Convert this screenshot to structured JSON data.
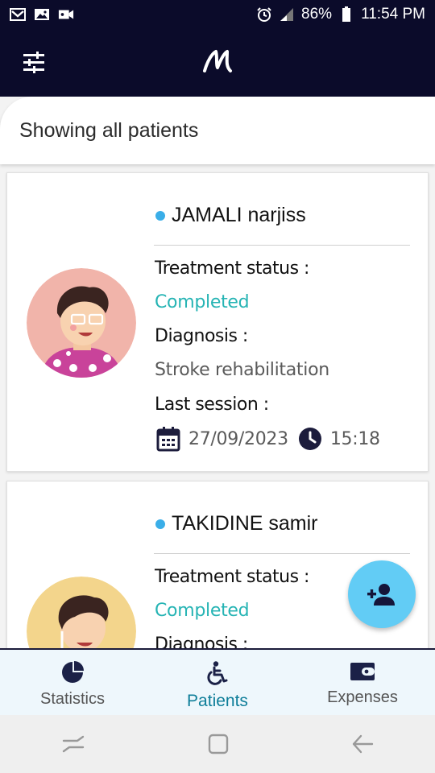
{
  "status_bar": {
    "battery": "86%",
    "time": "11:54 PM"
  },
  "header": {
    "title": "Showing all patients"
  },
  "patients": [
    {
      "name": "JAMALI narjiss",
      "treatment_status_label": "Treatment status :",
      "treatment_status": "Completed",
      "diagnosis_label": "Diagnosis :",
      "diagnosis": "Stroke rehabilitation",
      "last_session_label": "Last session :",
      "last_session_date": "27/09/2023",
      "last_session_time": "15:18"
    },
    {
      "name": "TAKIDINE samir",
      "treatment_status_label": "Treatment status :",
      "treatment_status": "Completed",
      "diagnosis_label": "Diagnosis :"
    }
  ],
  "bottom_nav": {
    "items": [
      {
        "label": "Statistics",
        "icon": "pie-chart-icon"
      },
      {
        "label": "Patients",
        "icon": "accessible-icon",
        "active": true
      },
      {
        "label": "Expenses",
        "icon": "wallet-icon"
      }
    ]
  },
  "colors": {
    "dark_navy": "#0b0b2a",
    "status_green": "#26b4b4",
    "accent_blue": "#3aaee8",
    "fab_blue": "#62ccf5",
    "active_nav": "#0e7e99"
  }
}
